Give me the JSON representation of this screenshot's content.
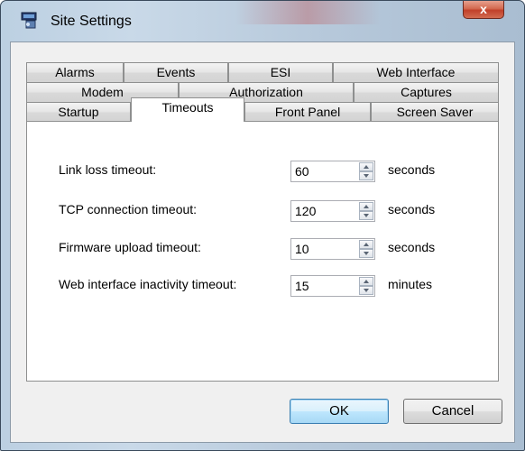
{
  "window": {
    "title": "Site Settings",
    "close_glyph": "x"
  },
  "tabs": {
    "row1": [
      "Alarms",
      "Events",
      "ESI",
      "Web Interface"
    ],
    "row2": [
      "Modem",
      "Authorization",
      "Captures"
    ],
    "row3": [
      "Startup",
      "Timeouts",
      "Front Panel",
      "Screen Saver"
    ],
    "active": "Timeouts"
  },
  "timeouts": {
    "link_loss": {
      "label": "Link loss timeout:",
      "value": "60",
      "unit": "seconds"
    },
    "tcp": {
      "label": "TCP connection timeout:",
      "value": "120",
      "unit": "seconds"
    },
    "firmware": {
      "label": "Firmware upload timeout:",
      "value": "10",
      "unit": "seconds"
    },
    "web": {
      "label": "Web interface inactivity timeout:",
      "value": "15",
      "unit": "minutes"
    }
  },
  "buttons": {
    "ok": "OK",
    "cancel": "Cancel"
  },
  "icons": {
    "app": "site-settings-icon",
    "close": "close-icon",
    "spin_up": "spin-up-icon",
    "spin_down": "spin-down-icon"
  },
  "colors": {
    "default_button_border": "#3c7fb1",
    "close_button": "#c1402a",
    "panel_bg": "#ffffff",
    "client_bg": "#f0f0f0"
  }
}
